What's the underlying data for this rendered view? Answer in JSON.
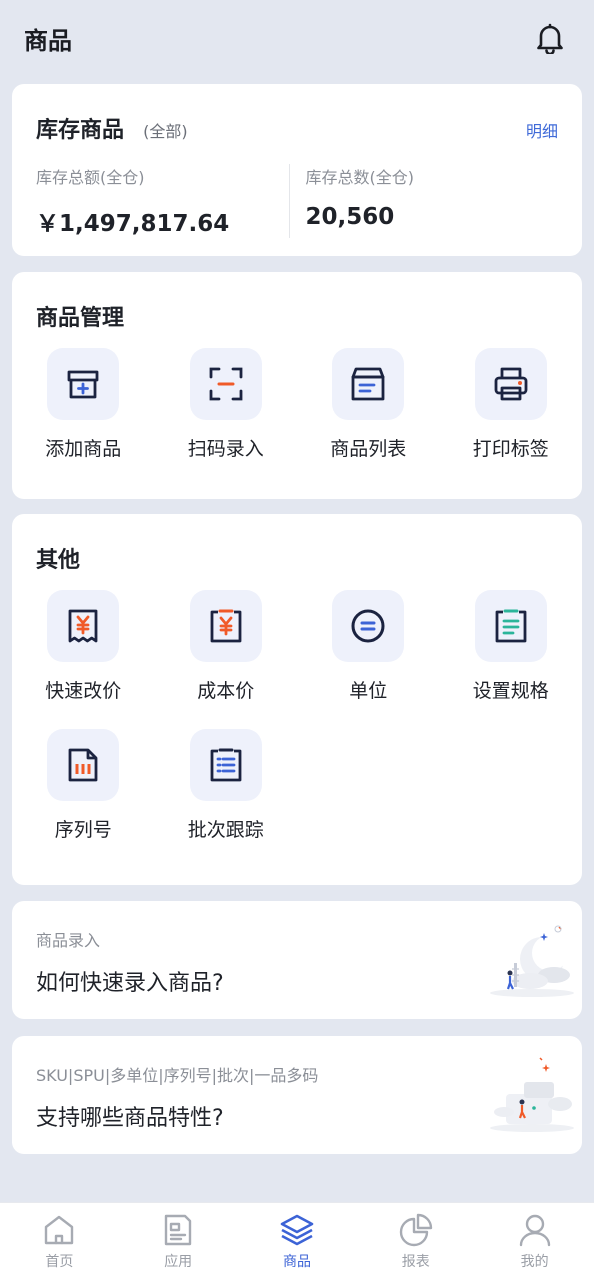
{
  "header": {
    "title": "商品"
  },
  "inventory": {
    "title": "库存商品",
    "scope": "(全部)",
    "detail_link": "明细",
    "amount_label": "库存总额(全仓)",
    "amount_value": "￥1,497,817.64",
    "count_label": "库存总数(全仓)",
    "count_value": "20,560"
  },
  "management": {
    "title": "商品管理",
    "items": [
      {
        "label": "添加商品",
        "icon": "add-product-icon"
      },
      {
        "label": "扫码录入",
        "icon": "scan-icon"
      },
      {
        "label": "商品列表",
        "icon": "product-list-icon"
      },
      {
        "label": "打印标签",
        "icon": "printer-icon"
      }
    ]
  },
  "other": {
    "title": "其他",
    "items": [
      {
        "label": "快速改价",
        "icon": "price-receipt-icon"
      },
      {
        "label": "成本价",
        "icon": "cost-price-icon"
      },
      {
        "label": "单位",
        "icon": "unit-icon"
      },
      {
        "label": "设置规格",
        "icon": "spec-icon"
      },
      {
        "label": "序列号",
        "icon": "serial-number-icon"
      },
      {
        "label": "批次跟踪",
        "icon": "batch-tracking-icon"
      }
    ]
  },
  "promos": [
    {
      "subtitle": "商品录入",
      "title": "如何快速录入商品?"
    },
    {
      "subtitle": "SKU|SPU|多单位|序列号|批次|一品多码",
      "title": "支持哪些商品特性?"
    }
  ],
  "tabbar": {
    "tabs": [
      {
        "label": "首页",
        "icon": "home-icon"
      },
      {
        "label": "应用",
        "icon": "apps-icon"
      },
      {
        "label": "商品",
        "icon": "layers-icon",
        "active": true
      },
      {
        "label": "报表",
        "icon": "pie-chart-icon"
      },
      {
        "label": "我的",
        "icon": "user-icon"
      }
    ]
  },
  "colors": {
    "accent": "#3c63d6",
    "orange": "#f05a28",
    "teal": "#2bb59a",
    "background": "#e3e7f0"
  }
}
